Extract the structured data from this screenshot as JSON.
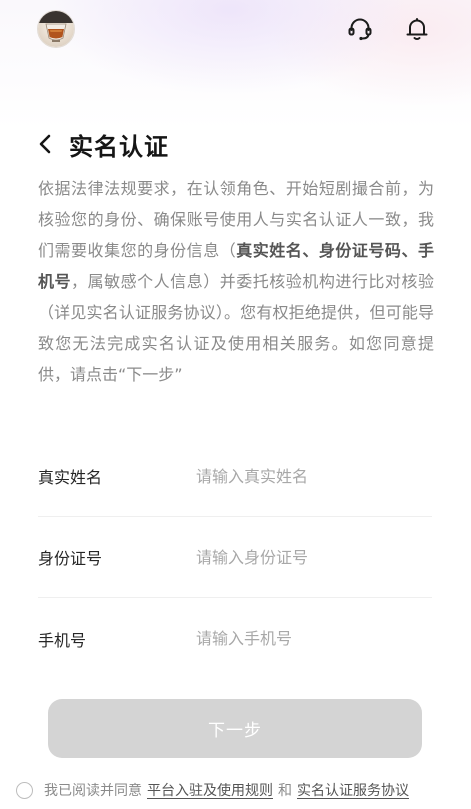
{
  "topbar": {
    "username": "",
    "avatar_icon": "avatar-drink-icon",
    "support_icon": "headset-icon",
    "notification_icon": "bell-icon"
  },
  "header": {
    "back_icon": "chevron-left-icon",
    "title": "实名认证"
  },
  "notice": {
    "part1": "依据法律法规要求，在认领角色、开始短剧撮合前，为核验您的身份、确保账号使用人与实名认证人一致，我们需要收集您的身份信息（",
    "bold": "真实姓名、身份证号码、手机号",
    "part2": "，属敏感个人信息）并委托核验机构进行比对核验（详见实名认证服务协议）。您有权拒绝提供，但可能导致您无法完成实名认证及使用相关服务。如您同意提供，请点击“下一步”"
  },
  "form": {
    "name_label": "真实姓名",
    "name_placeholder": "请输入真实姓名",
    "name_value": "",
    "id_label": "身份证号",
    "id_placeholder": "请输入身份证号",
    "id_value": "",
    "phone_label": "手机号",
    "phone_placeholder": "请输入手机号",
    "phone_value": ""
  },
  "next_button": {
    "label": "下一步",
    "enabled": false
  },
  "agreement": {
    "checked": false,
    "prefix": "我已阅读并同意",
    "link1": "平台入驻及使用规则",
    "conjunction": "和",
    "link2": "实名认证服务协议"
  },
  "colors": {
    "button_disabled": "#d4d4d4",
    "notice_text": "#8a8a8a",
    "title_text": "#151515"
  }
}
